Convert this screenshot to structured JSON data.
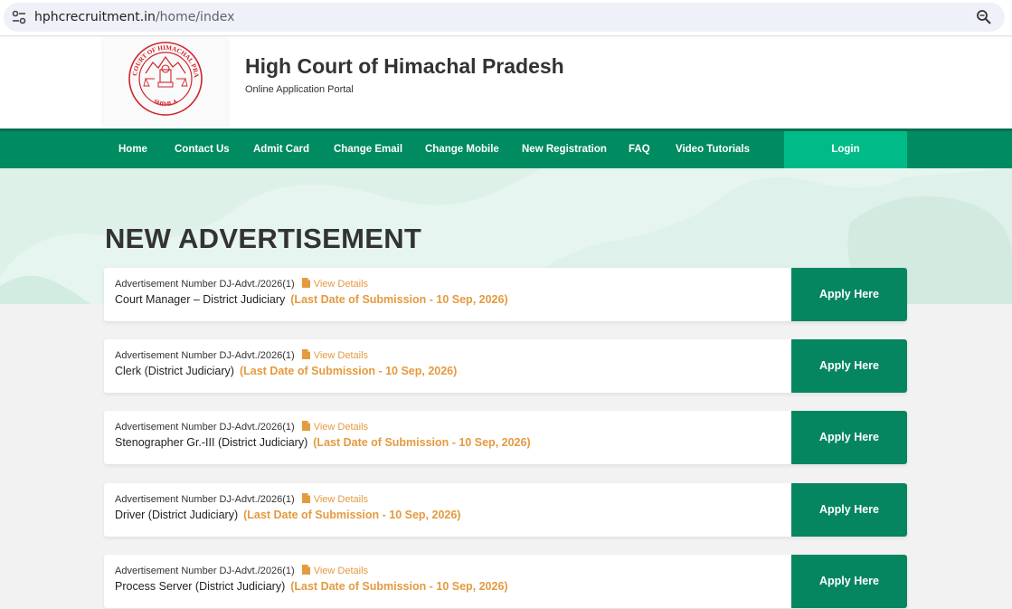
{
  "browser": {
    "url_host": "hphcrecruitment.in",
    "url_path": "/home/index"
  },
  "header": {
    "title": "High Court of Himachal Pradesh",
    "subtitle": "Online Application Portal",
    "logo_text_top": "HIGH COURT OF HIMACHAL PRADESH",
    "logo_text_bottom": "SHIMLA"
  },
  "nav": {
    "items": [
      {
        "label": "Home"
      },
      {
        "label": "Contact Us"
      },
      {
        "label": "Admit Card"
      },
      {
        "label": "Change Email"
      },
      {
        "label": "Change Mobile"
      },
      {
        "label": "New Registration"
      },
      {
        "label": "FAQ"
      },
      {
        "label": "Video Tutorials"
      }
    ],
    "login_label": "Login"
  },
  "main": {
    "section_title": "NEW ADVERTISEMENT",
    "adverts": [
      {
        "adv_number": "Advertisement Number DJ-Advt./2026(1)",
        "view_label": "View Details",
        "post": "Court Manager – District Judiciary",
        "deadline": "(Last Date of Submission - 10 Sep, 2026)",
        "apply_label": "Apply Here"
      },
      {
        "adv_number": "Advertisement Number DJ-Advt./2026(1)",
        "view_label": "View Details",
        "post": "Clerk (District Judiciary)",
        "deadline": "(Last Date of Submission - 10 Sep, 2026)",
        "apply_label": "Apply Here"
      },
      {
        "adv_number": "Advertisement Number DJ-Advt./2026(1)",
        "view_label": "View Details",
        "post": "Stenographer Gr.-III (District Judiciary)",
        "deadline": "(Last Date of Submission - 10 Sep, 2026)",
        "apply_label": "Apply Here"
      },
      {
        "adv_number": "Advertisement Number DJ-Advt./2026(1)",
        "view_label": "View Details",
        "post": "Driver (District Judiciary)",
        "deadline": "(Last Date of Submission - 10 Sep, 2026)",
        "apply_label": "Apply Here"
      },
      {
        "adv_number": "Advertisement Number DJ-Advt./2026(1)",
        "view_label": "View Details",
        "post": "Process Server (District Judiciary)",
        "deadline": "(Last Date of Submission - 10 Sep, 2026)",
        "apply_label": "Apply Here"
      }
    ]
  },
  "colors": {
    "nav_green": "#008b61",
    "login_green": "#00bb88",
    "apply_green": "#068660",
    "accent_orange": "#e49a3f",
    "seal_red": "#d2232a"
  },
  "icons": {
    "site_info": "tune-icon",
    "zoom": "zoom-icon",
    "view_details": "pdf-file-icon"
  }
}
